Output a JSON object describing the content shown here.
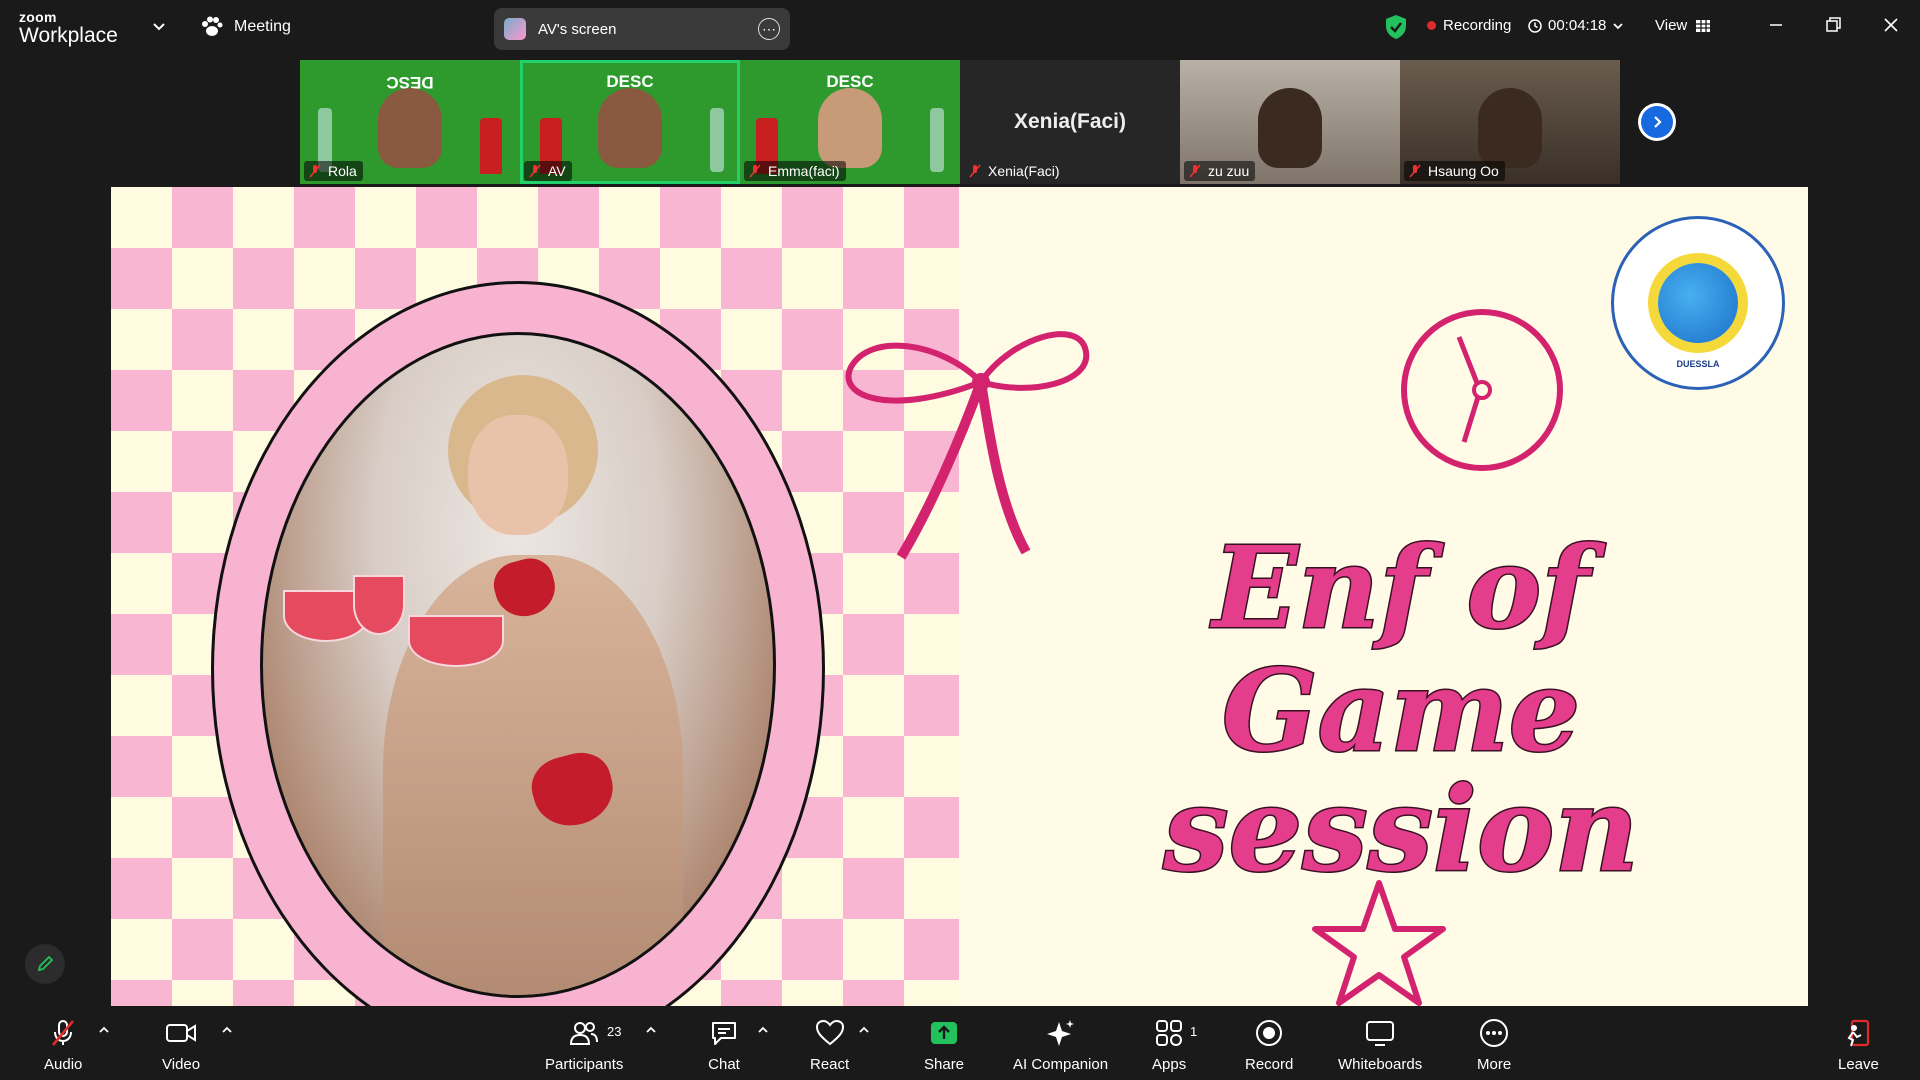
{
  "app": {
    "brand_small": "zoom",
    "brand_big": "Workplace",
    "meeting_label": "Meeting"
  },
  "screen_share": {
    "label": "AV's screen"
  },
  "status": {
    "recording_label": "Recording",
    "timer": "00:04:18",
    "view_label": "View"
  },
  "participants_strip": [
    {
      "name": "Rola",
      "type": "video",
      "logo": "DESC"
    },
    {
      "name": "AV",
      "type": "video",
      "logo": "DESC",
      "active": true
    },
    {
      "name": "Emma(faci)",
      "type": "video",
      "logo": "DESC"
    },
    {
      "name": "Xenia(Faci)",
      "type": "avatar",
      "display_name": "Xenia(Faci)"
    },
    {
      "name": "zu zuu",
      "type": "video"
    },
    {
      "name": "Hsaung Oo",
      "type": "video"
    }
  ],
  "slide": {
    "title_line1": "Enf of Game",
    "title_line2": "session",
    "org_seal_text": "DUESSLA",
    "colors": {
      "title": "#e33d8c",
      "checker_pink": "#f8b6d2",
      "checker_cream": "#fffbe0",
      "background": "#fffbe6"
    }
  },
  "toolbar": {
    "audio": "Audio",
    "video": "Video",
    "participants": "Participants",
    "participants_count": "23",
    "chat": "Chat",
    "react": "React",
    "share": "Share",
    "ai_companion": "AI Companion",
    "apps": "Apps",
    "apps_count": "1",
    "record": "Record",
    "whiteboards": "Whiteboards",
    "more": "More",
    "leave": "Leave"
  },
  "icons": {
    "shield": "shield-check-icon",
    "clock": "clock-icon",
    "mic_muted": "mic-muted-icon",
    "camera": "camera-icon"
  }
}
